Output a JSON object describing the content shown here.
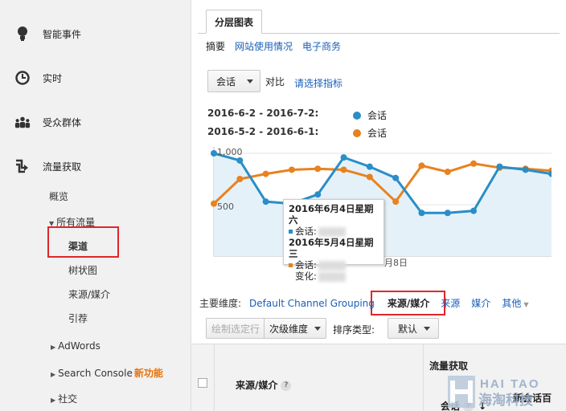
{
  "sidebar": {
    "items": [
      {
        "icon": "lightbulb-icon",
        "label": "智能事件"
      },
      {
        "icon": "clock-icon",
        "label": "实时"
      },
      {
        "icon": "people-icon",
        "label": "受众群体"
      },
      {
        "icon": "acquisition-icon",
        "label": "流量获取"
      }
    ],
    "sub_items": {
      "overview": "概览",
      "all_traffic": "所有流量",
      "channels": "渠道",
      "treemap": "树状图",
      "source_medium": "来源/媒介",
      "referrals": "引荐",
      "adwords": "AdWords",
      "search_console": "Search Console",
      "new_feature": "新功能",
      "social": "社交"
    }
  },
  "report": {
    "tab": "分层图表",
    "subtabs": [
      "摘要",
      "网站使用情况",
      "电子商务"
    ],
    "metric": "会话",
    "compare_label": "对比",
    "choose_metric": "请选择指标",
    "range_current": "2016-6-2 - 2016-7-2:",
    "range_previous": "2016-5-2 - 2016-6-1:",
    "legend_current": "会话",
    "legend_previous": "会话"
  },
  "colors": {
    "current": "#2a8ec7",
    "previous": "#e8821e",
    "highlight": "#e0252a",
    "link": "#1a5eb8"
  },
  "chart_data": {
    "type": "line",
    "y_tick_labels": [
      "1,000",
      "500"
    ],
    "x_tick_label": "月8日",
    "series": [
      {
        "name": "会话",
        "values": [
          1000,
          930,
          530,
          510,
          600,
          960,
          870,
          760,
          420,
          420,
          440,
          870,
          840,
          800
        ]
      },
      {
        "name": "会话",
        "values": [
          510,
          750,
          800,
          840,
          850,
          840,
          770,
          530,
          880,
          820,
          900,
          860,
          850,
          830
        ]
      }
    ]
  },
  "tooltip": {
    "date_current": "2016年6月4日星期六",
    "label_current": "会话:",
    "date_previous": "2016年5月4日星期三",
    "label_previous": "会话:",
    "change_label": "变化:"
  },
  "dimensions": {
    "label": "主要维度:",
    "options": [
      "Default Channel Grouping",
      "来源/媒介",
      "来源",
      "媒介",
      "其他"
    ]
  },
  "toolbar": {
    "plot_rows": "绘制选定行",
    "secondary_dim": "次级维度",
    "sort_type_label": "排序类型:",
    "sort_value": "默认"
  },
  "table": {
    "col_source_medium": "来源/媒介",
    "group_acquisition": "流量获取",
    "col_sessions": "会话",
    "col_new_sessions": "新会话百"
  },
  "watermark": {
    "latin": "HAI TAO",
    "cn": "海淘科技"
  }
}
